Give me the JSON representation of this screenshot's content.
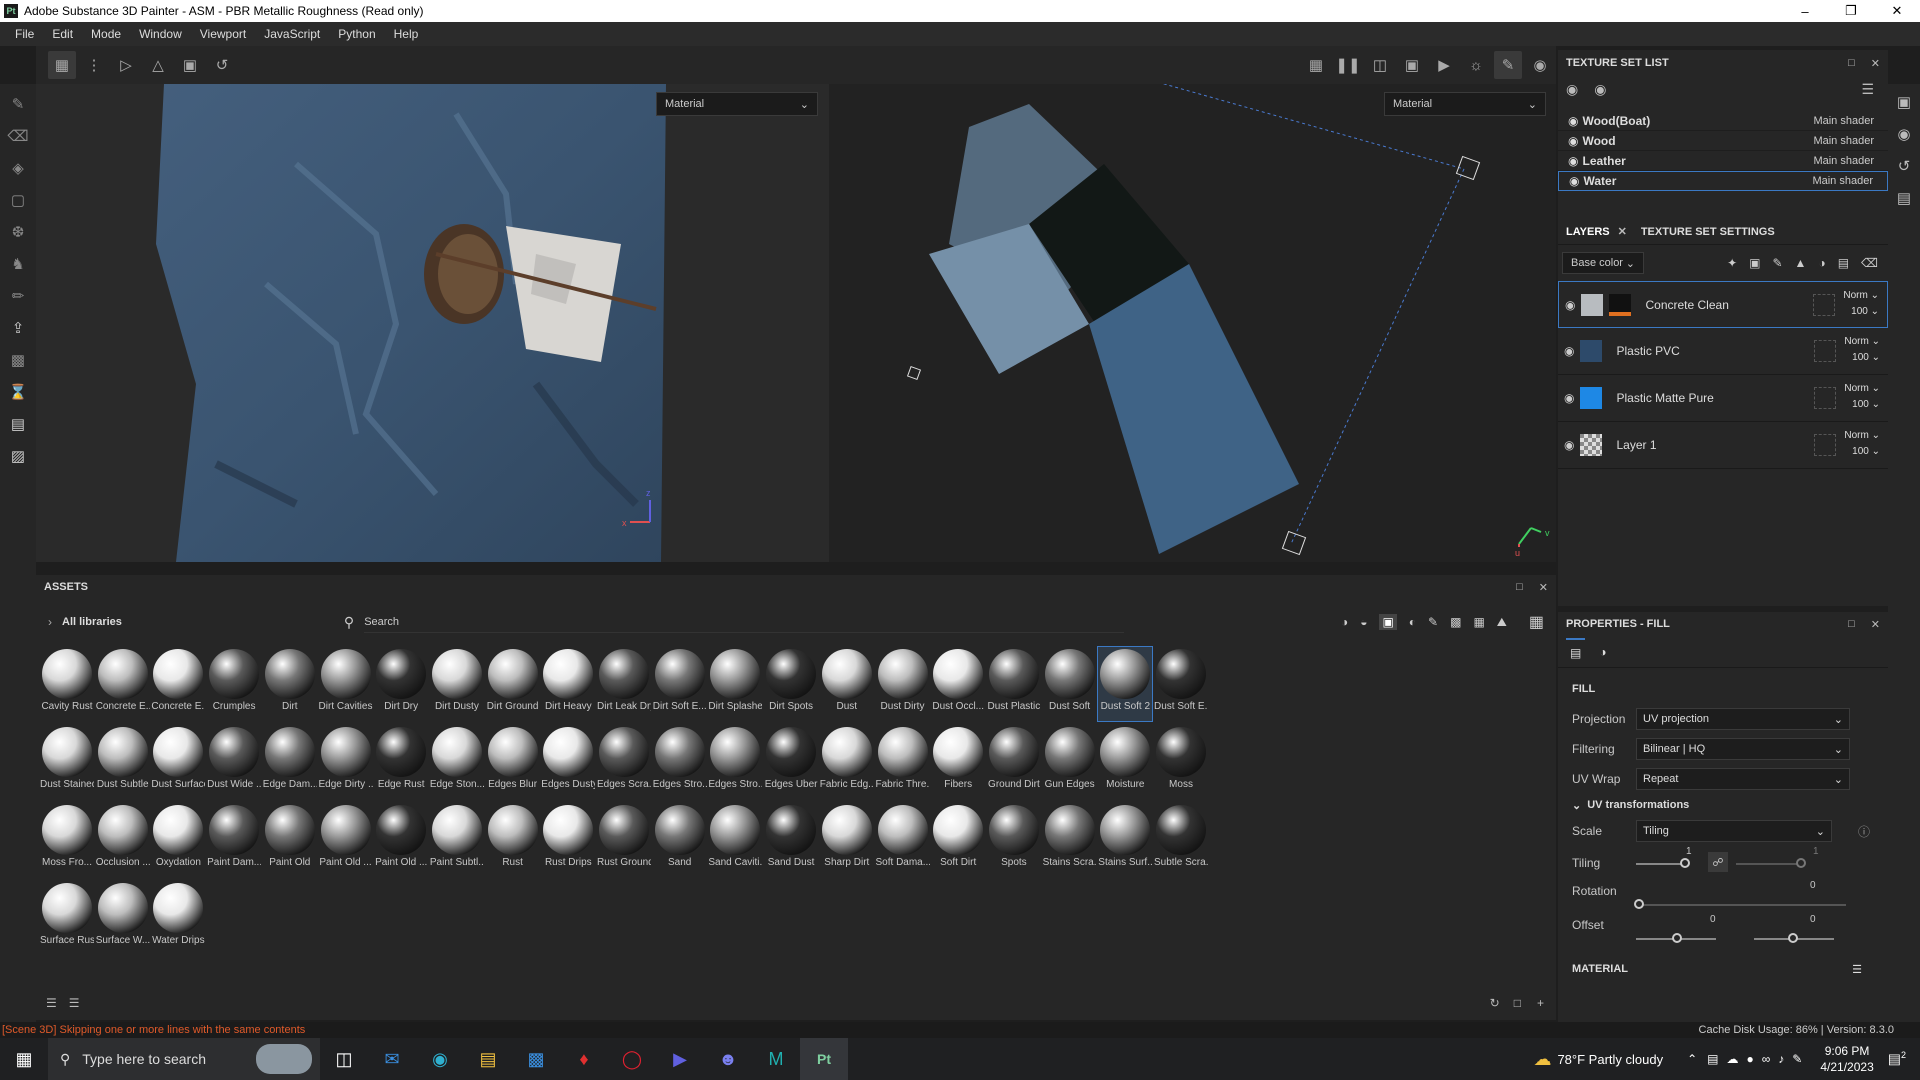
{
  "window": {
    "title": "Adobe Substance 3D Painter - ASM - PBR Metallic Roughness (Read only)",
    "app_icon": "Pt"
  },
  "menu": [
    "File",
    "Edit",
    "Mode",
    "Window",
    "Viewport",
    "JavaScript",
    "Python",
    "Help"
  ],
  "viewport3d": {
    "mode": "Material",
    "axis_x": "x",
    "axis_z": "z"
  },
  "viewport2d": {
    "mode": "Material",
    "axis_u": "u",
    "axis_v": "v"
  },
  "texture_set_list": {
    "title": "TEXTURE SET LIST",
    "items": [
      {
        "name": "Wood(Boat)",
        "shader": "Main shader"
      },
      {
        "name": "Wood",
        "shader": "Main shader"
      },
      {
        "name": "Leather",
        "shader": "Main shader"
      },
      {
        "name": "Water",
        "shader": "Main shader"
      }
    ]
  },
  "layers": {
    "tab_layers": "LAYERS",
    "tab_settings": "TEXTURE SET SETTINGS",
    "channel": "Base color",
    "items": [
      {
        "name": "Concrete Clean",
        "blend": "Norm",
        "opacity": "100"
      },
      {
        "name": "Plastic PVC",
        "blend": "Norm",
        "opacity": "100"
      },
      {
        "name": "Plastic Matte Pure",
        "blend": "Norm",
        "opacity": "100"
      },
      {
        "name": "Layer 1",
        "blend": "Norm",
        "opacity": "100"
      }
    ]
  },
  "assets": {
    "title": "ASSETS",
    "library": "All libraries",
    "search_placeholder": "Search",
    "rows": [
      [
        "Cavity Rust",
        "Concrete E...",
        "Concrete E...",
        "Crumples",
        "Dirt",
        "Dirt Cavities",
        "Dirt Dry",
        "Dirt Dusty",
        "Dirt Ground",
        "Dirt Heavy",
        "Dirt Leak Dry",
        "Dirt Soft E...",
        "Dirt Splashes",
        "Dirt Spots",
        "Dust",
        "Dust Dirty",
        "Dust Occl...",
        "Dust Plastic",
        "Dust Soft",
        "Dust Soft 2",
        "Dust Soft E..."
      ],
      [
        "Dust Stained",
        "Dust Subtle",
        "Dust Surface",
        "Dust Wide ...",
        "Edge Dam...",
        "Edge Dirty ...",
        "Edge Rust",
        "Edge Ston...",
        "Edges Blur",
        "Edges Dusty",
        "Edges Scra...",
        "Edges Stro...",
        "Edges Stro...",
        "Edges Uber",
        "Fabric Edg...",
        "Fabric Thre...",
        "Fibers",
        "Ground Dirt",
        "Gun Edges",
        "Moisture",
        "Moss"
      ],
      [
        "Moss Fro...",
        "Occlusion ...",
        "Oxydation",
        "Paint Dam...",
        "Paint Old",
        "Paint Old ...",
        "Paint Old ...",
        "Paint Subtl...",
        "Rust",
        "Rust Drips",
        "Rust Ground",
        "Sand",
        "Sand Caviti...",
        "Sand Dust",
        "Sharp Dirt",
        "Soft Dama...",
        "Soft Dirt",
        "Spots",
        "Stains Scra...",
        "Stains Surf...",
        "Subtle Scra..."
      ],
      [
        "Surface Rust",
        "Surface W...",
        "Water Drips"
      ]
    ],
    "selected": "Dust Soft 2"
  },
  "properties": {
    "title": "PROPERTIES - FILL",
    "section": "FILL",
    "projection_label": "Projection",
    "projection": "UV projection",
    "filtering_label": "Filtering",
    "filtering": "Bilinear | HQ",
    "uvwrap_label": "UV Wrap",
    "uvwrap": "Repeat",
    "uvtrans": "UV transformations",
    "scale_label": "Scale",
    "scale": "Tiling",
    "tiling_label": "Tiling",
    "tiling_val1": "1",
    "tiling_val2": "1",
    "rotation_label": "Rotation",
    "rotation_val": "0",
    "offset_label": "Offset",
    "offset_val1": "0",
    "offset_val2": "0",
    "material": "MATERIAL"
  },
  "status": {
    "message": "[Scene 3D] Skipping one or more lines with the same contents",
    "cache": "Cache Disk Usage:   86% | Version: 8.3.0"
  },
  "taskbar": {
    "search_placeholder": "Type here to search",
    "weather": "78°F  Partly cloudy",
    "time": "9:06 PM",
    "date": "4/21/2023",
    "notif": "2"
  }
}
